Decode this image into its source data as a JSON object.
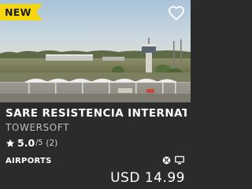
{
  "badge": {
    "label": "NEW",
    "color": "#f5d60f"
  },
  "wishlist": {
    "icon": "heart-outline-icon"
  },
  "product": {
    "title": "SARE RESISTENCIA INTERNATIONAL",
    "publisher": "TOWERSOFT",
    "rating": {
      "icon": "star-icon",
      "score": "5.0",
      "out_of": "/5",
      "count": "(2)"
    },
    "category": "AIRPORTS",
    "platforms": [
      "xbox-icon",
      "pc-monitor-icon"
    ],
    "price": "USD 14.99"
  },
  "thumbnail": {
    "subject": "airport-scene-image"
  }
}
